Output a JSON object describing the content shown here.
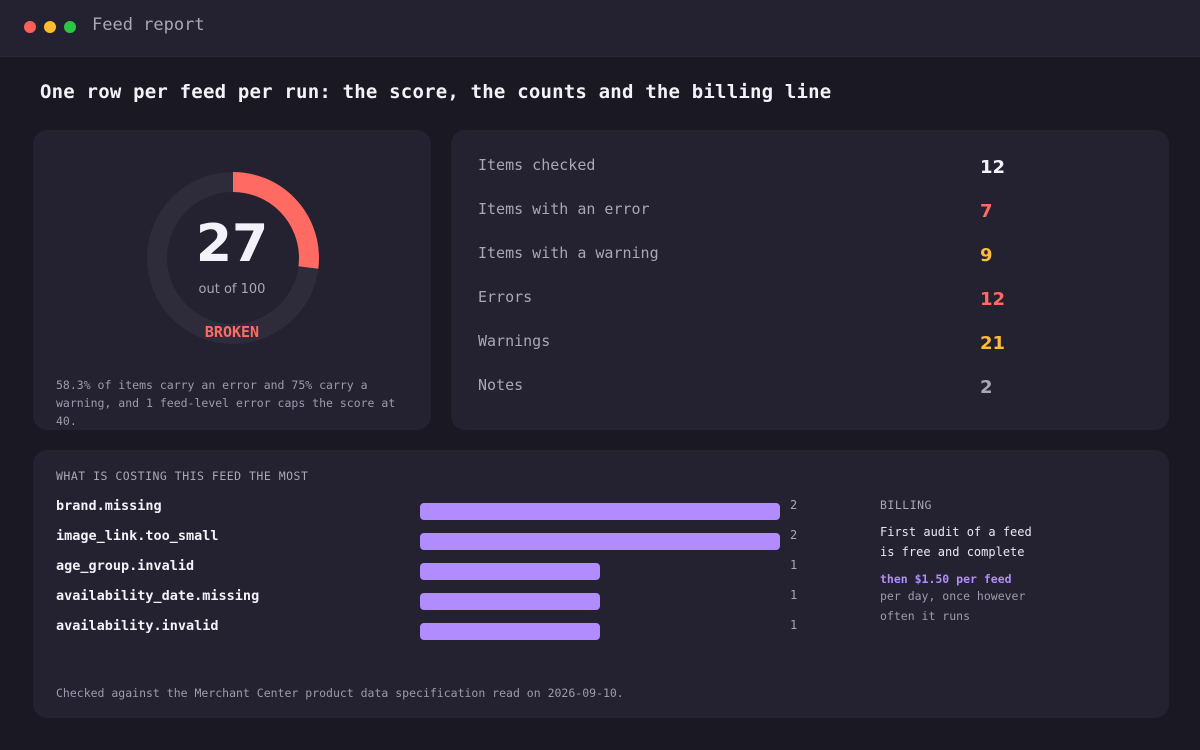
{
  "window": {
    "title": "Feed report"
  },
  "page": {
    "title": "One row per feed per run: the score, the counts and the billing line"
  },
  "score": {
    "value": "27",
    "out_of": "out of 100",
    "status": "BROKEN",
    "fraction": 0.27,
    "note": "58.3% of items carry an error and 75% carry a warning, and 1 feed-level error caps the score at 40.",
    "colors": {
      "arc": "#ff6b63",
      "track": "#2e2b3b"
    }
  },
  "counts": [
    {
      "label": "Items checked",
      "value": "12",
      "color": "#f3f1f9"
    },
    {
      "label": "Items with an error",
      "value": "7",
      "color": "#ff6b63"
    },
    {
      "label": "Items with a warning",
      "value": "9",
      "color": "#ffbb3d"
    },
    {
      "label": "Errors",
      "value": "12",
      "color": "#ff6b63"
    },
    {
      "label": "Warnings",
      "value": "21",
      "color": "#ffbb3d"
    },
    {
      "label": "Notes",
      "value": "2",
      "color": "#a9a6b6"
    }
  ],
  "costs": {
    "heading": "WHAT IS COSTING THIS FEED THE MOST",
    "max": 2,
    "items": [
      {
        "name": "brand.missing",
        "count": "2",
        "value": 2
      },
      {
        "name": "image_link.too_small",
        "count": "2",
        "value": 2
      },
      {
        "name": "age_group.invalid",
        "count": "1",
        "value": 1
      },
      {
        "name": "availability_date.missing",
        "count": "1",
        "value": 1
      },
      {
        "name": "availability.invalid",
        "count": "1",
        "value": 1
      }
    ],
    "footnote": "Checked against the Merchant Center product data specification read on 2026-09-10."
  },
  "billing": {
    "heading": "BILLING",
    "line1": "First audit of a feed is free and complete",
    "price": "then $1.50 per feed",
    "line2": "per day, once however often it runs"
  }
}
